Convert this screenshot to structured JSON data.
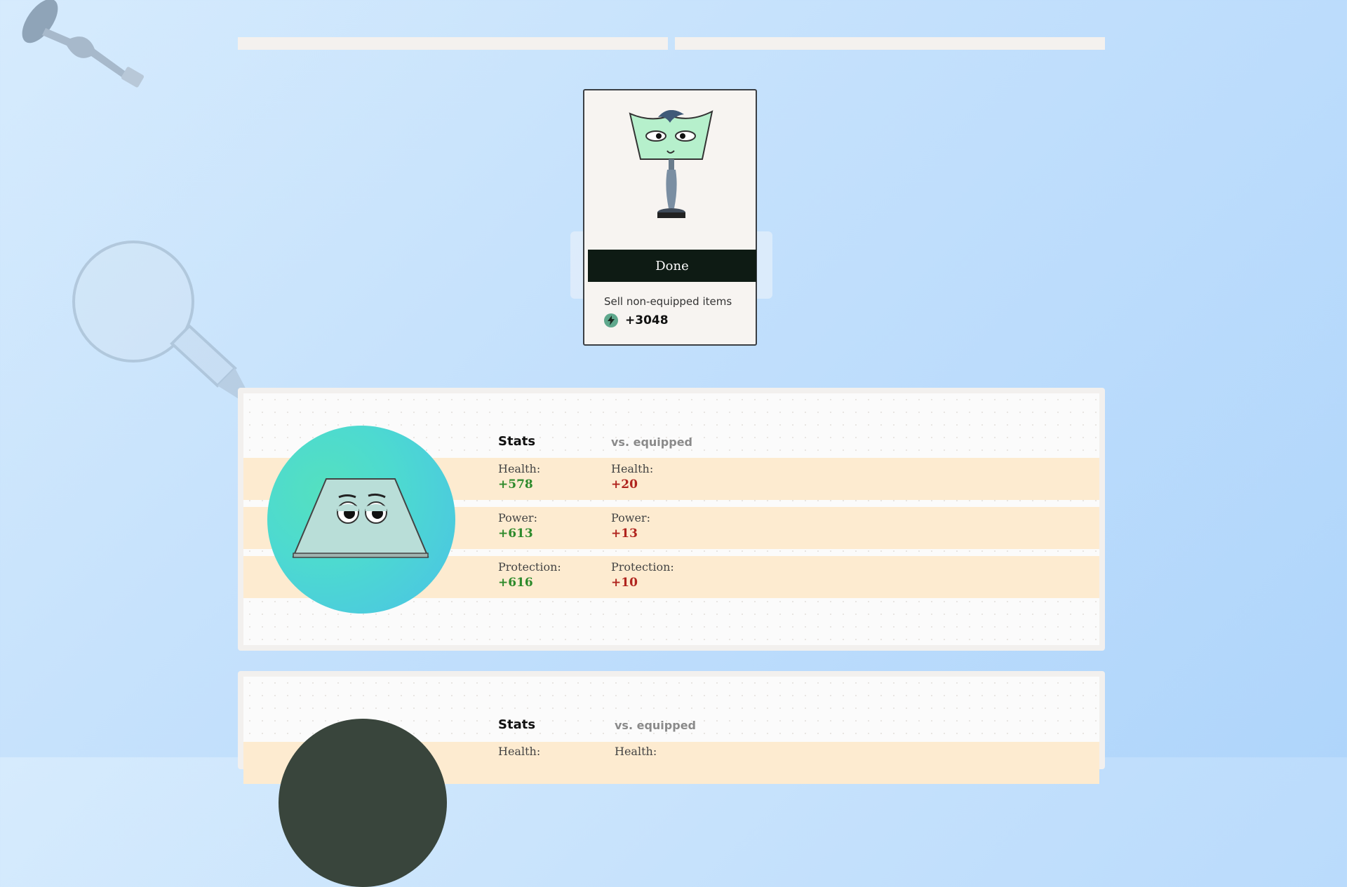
{
  "summary": {
    "done_label": "Done",
    "sell_label": "Sell non-equipped items",
    "sell_amount": "+3048",
    "currency_icon": "lightning-coin-icon"
  },
  "items": [
    {
      "stats_header": "Stats",
      "compare_header": "vs. equipped",
      "rows": [
        {
          "label": "Health:",
          "value": "+578",
          "cmp_label": "Health:",
          "cmp_value": "+20"
        },
        {
          "label": "Power:",
          "value": "+613",
          "cmp_label": "Power:",
          "cmp_value": "+13"
        },
        {
          "label": "Protection:",
          "value": "+616",
          "cmp_label": "Protection:",
          "cmp_value": "+10"
        }
      ]
    },
    {
      "stats_header": "Stats",
      "compare_header": "vs. equipped",
      "rows": [
        {
          "label": "Health:",
          "cmp_label": "Health:"
        }
      ]
    }
  ],
  "colors": {
    "positive": "#2d8a2b",
    "negative": "#b0241e",
    "button_bg": "#0e1b14",
    "band": "#fdebd0"
  }
}
